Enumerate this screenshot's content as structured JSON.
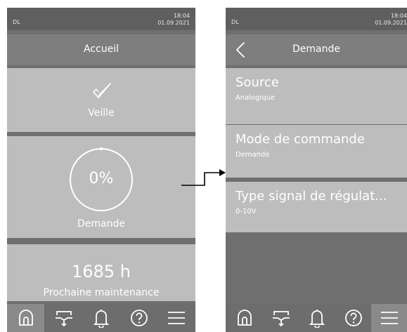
{
  "left_screen": {
    "status": {
      "language": "DL",
      "time": "18:04",
      "date": "01.09.2021"
    },
    "title": "Accueil",
    "status_card": {
      "label": "Veille"
    },
    "demand_card": {
      "value": "0%",
      "label": "Demande"
    },
    "maintenance_card": {
      "value": "1685 h",
      "label": "Prochaine maintenance"
    }
  },
  "right_screen": {
    "status": {
      "language": "DL",
      "time": "18:04",
      "date": "01.09.2021"
    },
    "title": "Demande",
    "items": [
      {
        "title": "Source",
        "value": "Analogique"
      },
      {
        "title": "Mode de commande",
        "value": "Demande"
      },
      {
        "title": "Type signal de régulat...",
        "value": "0-10V"
      }
    ]
  },
  "icons": [
    "home-icon",
    "humidifier-icon",
    "bell-icon",
    "help-icon",
    "menu-icon",
    "back-icon",
    "checkmark-icon"
  ],
  "colors": {
    "background": "#ffffff",
    "panel": "#6f6f6f",
    "card": "#bdbdbd",
    "title_bar": "#7e7e7e",
    "text": "#ffffff",
    "accent": "#000000"
  }
}
